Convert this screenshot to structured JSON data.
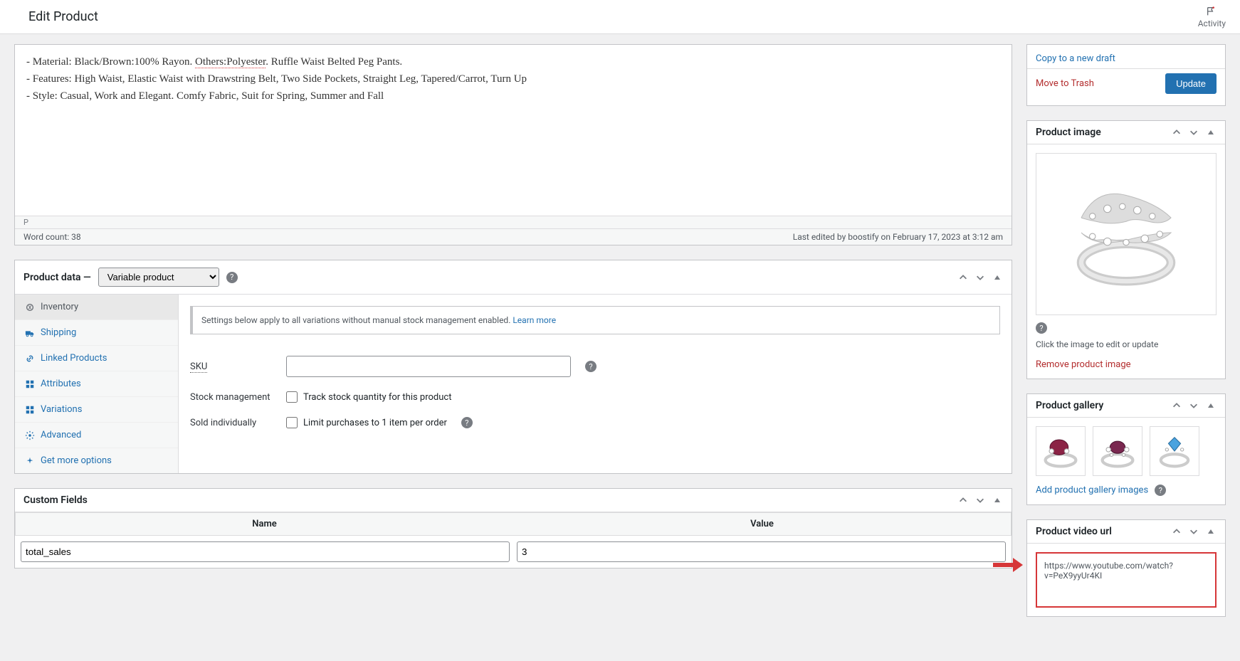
{
  "topbar": {
    "title": "Edit Product",
    "activity_label": "Activity"
  },
  "editor": {
    "line1_pre": "- Material: Black/Brown:100% Rayon. ",
    "line1_underlined": "Others:Polyester",
    "line1_post": ". Ruffle Waist Belted Peg Pants.",
    "line2": "- Features: High Waist, Elastic Waist with Drawstring Belt, Two Side Pockets, Straight Leg, Tapered/Carrot, Turn Up",
    "line3": "- Style: Casual, Work and Elegant. Comfy Fabric, Suit for Spring, Summer and Fall",
    "path": "P",
    "wordcount": "Word count: 38",
    "lastedit": "Last edited by boostify on February 17, 2023 at 3:12 am"
  },
  "productdata": {
    "title": "Product data —",
    "type_selected": "Variable product",
    "tabs": {
      "inventory": "Inventory",
      "shipping": "Shipping",
      "linked": "Linked Products",
      "attributes": "Attributes",
      "variations": "Variations",
      "advanced": "Advanced",
      "getmore": "Get more options"
    },
    "notice_text": "Settings below apply to all variations without manual stock management enabled. ",
    "notice_link": "Learn more",
    "sku_label": "SKU",
    "stock_label": "Stock management",
    "stock_chk": "Track stock quantity for this product",
    "sold_label": "Sold individually",
    "sold_chk": "Limit purchases to 1 item per order"
  },
  "publish": {
    "copy": "Copy to a new draft",
    "trash": "Move to Trash",
    "update": "Update"
  },
  "productimage": {
    "title": "Product image",
    "click_text": "Click the image to edit or update",
    "remove": "Remove product image"
  },
  "gallery": {
    "title": "Product gallery",
    "add": "Add product gallery images"
  },
  "videourl": {
    "title": "Product video url",
    "value": "https://www.youtube.com/watch?v=PeX9yyUr4KI"
  },
  "customfields": {
    "title": "Custom Fields",
    "col_name": "Name",
    "col_value": "Value",
    "row1_name": "total_sales",
    "row1_value": "3"
  }
}
